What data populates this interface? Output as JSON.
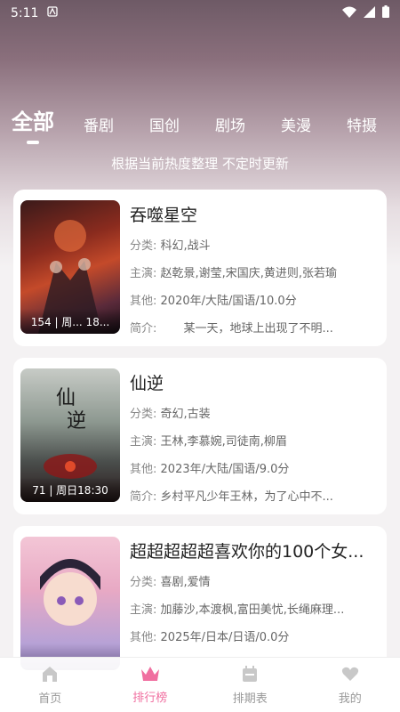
{
  "status_bar": {
    "time": "5:11"
  },
  "tabs": [
    {
      "label": "全部",
      "active": true
    },
    {
      "label": "番剧"
    },
    {
      "label": "国创"
    },
    {
      "label": "剧场"
    },
    {
      "label": "美漫"
    },
    {
      "label": "特摄"
    }
  ],
  "subtitle": "根据当前热度整理 不定时更新",
  "labels": {
    "genre": "分类:",
    "cast": "主演:",
    "other": "其他:",
    "intro": "简介:"
  },
  "items": [
    {
      "title": "吞噬星空",
      "genre": "科幻,战斗",
      "cast": "赵乾景,谢莹,宋国庆,黄进则,张若瑜",
      "other": "2020年/大陆/国语/10.0分",
      "intro": "　　某一天，地球上出现了不明...",
      "badge": "154 | 周... 18..."
    },
    {
      "title": "仙逆",
      "genre": "奇幻,古装",
      "cast": "王林,李慕婉,司徒南,柳眉",
      "other": "2023年/大陆/国语/9.0分",
      "intro": "乡村平凡少年王林，为了心中不...",
      "badge": "71 | 周日18:30"
    },
    {
      "title": "超超超超超喜欢你的100个女...",
      "genre": "喜剧,爱情",
      "cast": "加藤沙,本渡枫,富田美忧,长绳麻理...",
      "other": "2025年/日本/日语/0.0分",
      "intro": "",
      "badge": ""
    }
  ],
  "bottom_nav": [
    {
      "label": "首页",
      "icon": "home-icon"
    },
    {
      "label": "排行榜",
      "icon": "crown-icon",
      "active": true
    },
    {
      "label": "排期表",
      "icon": "calendar-icon"
    },
    {
      "label": "我的",
      "icon": "heart-icon"
    }
  ],
  "colors": {
    "accent": "#f06fa0"
  }
}
